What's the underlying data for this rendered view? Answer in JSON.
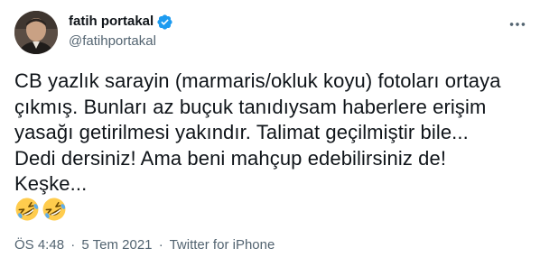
{
  "author": {
    "display_name": "fatih portakal",
    "handle": "@fatihportakal",
    "verified": true
  },
  "tweet": {
    "lines": [
      "CB yazlık sarayin (marmaris/okluk koyu) fotoları ortaya",
      "çıkmış. Bunları az buçuk tanıdıysam haberlere erişim",
      "yasağı getirilmesi yakındır. Talimat geçilmiştir bile...",
      "Dedi dersiniz! Ama beni mahçup edebilirsiniz de!",
      "Keşke..."
    ],
    "emojis": [
      "rolling-on-floor-laughing",
      "rolling-on-floor-laughing"
    ]
  },
  "meta": {
    "time": "ÖS 4:48",
    "separator": "·",
    "date": "5 Tem 2021",
    "source": "Twitter for iPhone"
  },
  "colors": {
    "text": "#0f1419",
    "secondary": "#536471",
    "verified": "#1d9bf0",
    "emoji_face": "#ffcc4d"
  },
  "icons": {
    "more": "more-options-icon",
    "verified": "verified-badge-icon"
  }
}
